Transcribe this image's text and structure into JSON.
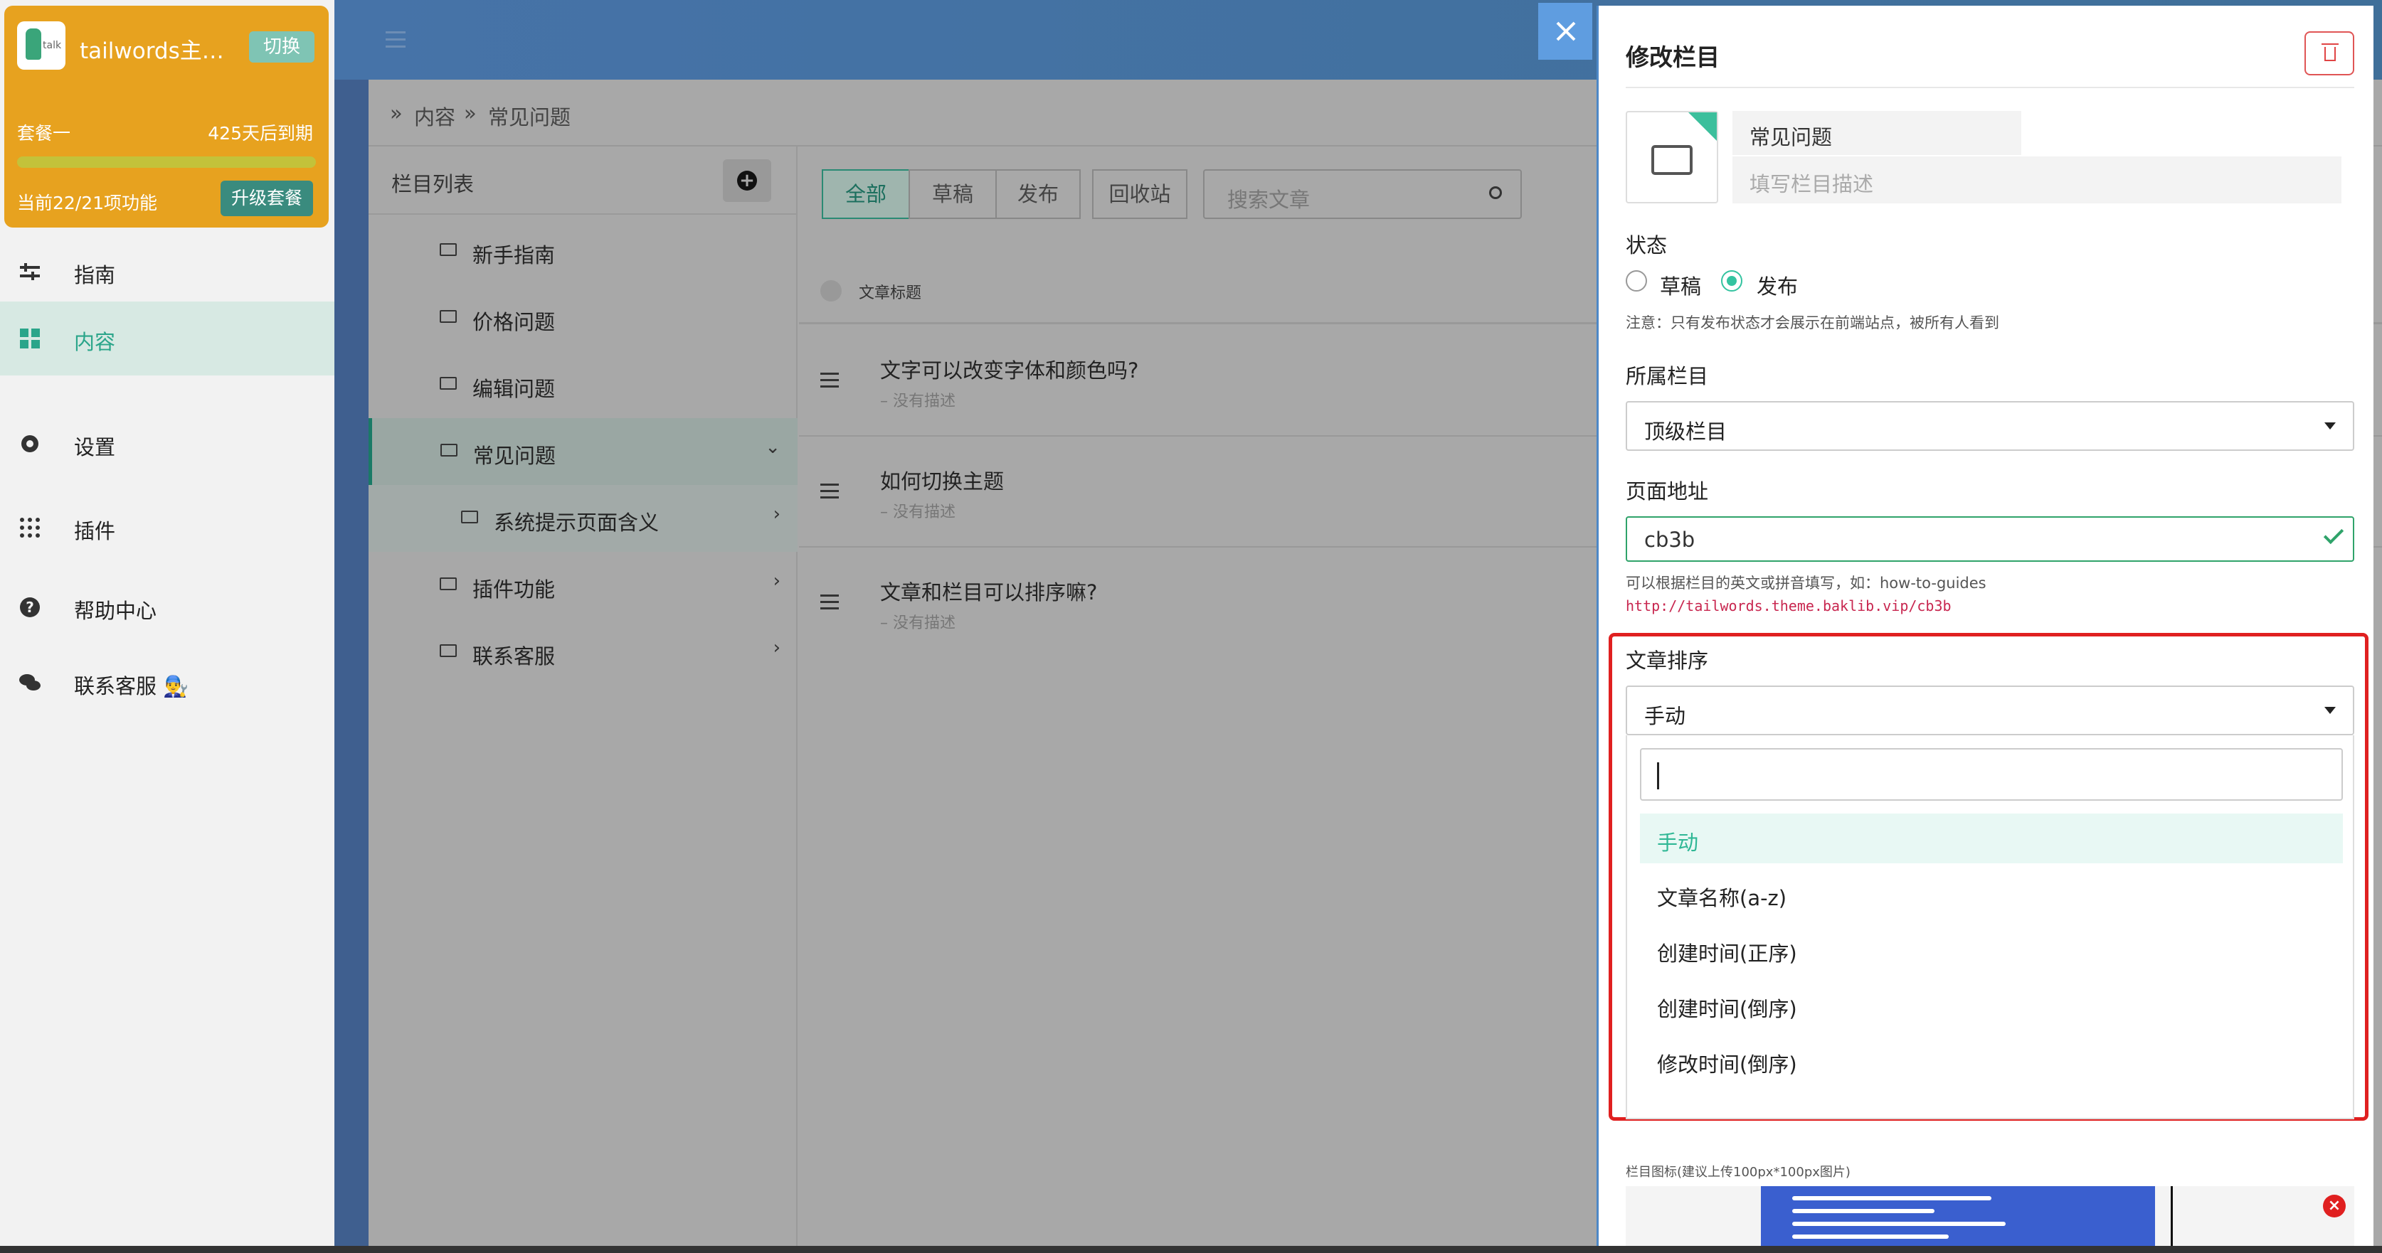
{
  "sidebar": {
    "site_name": "tailwords主题...",
    "switch_label": "切换",
    "plan_name": "套餐一",
    "plan_expire": "425天后到期",
    "plan_features": "当前22/21项功能",
    "upgrade_label": "升级套餐",
    "items": [
      {
        "label": "指南",
        "icon": "sliders-icon"
      },
      {
        "label": "内容",
        "icon": "grid-icon"
      },
      {
        "label": "设置",
        "icon": "gear-icon"
      },
      {
        "label": "插件",
        "icon": "apps-icon"
      },
      {
        "label": "帮助中心",
        "icon": "help-icon"
      },
      {
        "label": "联系客服 👨‍🔧",
        "icon": "chat-icon"
      }
    ],
    "active_index": 1
  },
  "breadcrumb": [
    "内容",
    "常见问题"
  ],
  "columns": {
    "title": "栏目列表",
    "items": [
      {
        "label": "新手指南",
        "chevron": ""
      },
      {
        "label": "价格问题",
        "chevron": ""
      },
      {
        "label": "编辑问题",
        "chevron": ""
      },
      {
        "label": "常见问题",
        "chevron": "⌄"
      },
      {
        "label": "系统提示页面含义",
        "chevron": "›"
      },
      {
        "label": "插件功能",
        "chevron": "›"
      },
      {
        "label": "联系客服",
        "chevron": "›"
      }
    ]
  },
  "articles": {
    "tabs": [
      "全部",
      "草稿",
      "发布",
      "回收站"
    ],
    "search_placeholder": "搜索文章",
    "header": "文章标题",
    "rows": [
      {
        "title": "文字可以改变字体和颜色吗?",
        "desc": "– 没有描述"
      },
      {
        "title": "如何切换主题",
        "desc": "– 没有描述"
      },
      {
        "title": "文章和栏目可以排序嘛?",
        "desc": "– 没有描述"
      }
    ]
  },
  "drawer": {
    "title": "修改栏目",
    "name_value": "常见问题",
    "desc_placeholder": "填写栏目描述",
    "status_label": "状态",
    "status_draft": "草稿",
    "status_publish": "发布",
    "status_note": "注意：只有发布状态才会展示在前端站点，被所有人看到",
    "parent_label": "所属栏目",
    "parent_value": "顶级栏目",
    "url_label": "页面地址",
    "url_value": "cb3b",
    "url_hint": "可以根据栏目的英文或拼音填写，如：how-to-guides",
    "url_link": "http://tailwords.theme.baklib.vip/cb3b",
    "sort_label": "文章排序",
    "sort_value": "手动",
    "sort_options": [
      "手动",
      "文章名称(a-z)",
      "创建时间(正序)",
      "创建时间(倒序)",
      "修改时间(倒序)"
    ],
    "icon_label": "栏目图标(建议上传100px*100px图片)"
  },
  "colors": {
    "accent": "#2fb795",
    "highlight": "#e02020",
    "plan": "#e7a21f"
  }
}
